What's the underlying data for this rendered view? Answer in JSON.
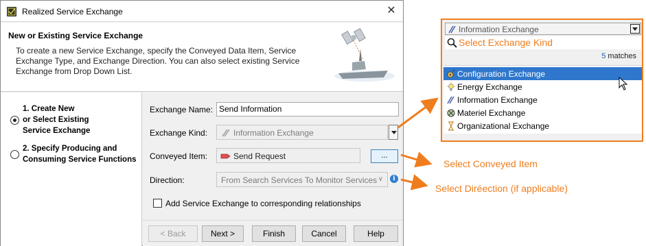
{
  "dialog": {
    "title": "Realized Service Exchange",
    "header_title": "New or Existing Service Exchange",
    "header_desc": "To create a new Service Exchange, specify the Conveyed Data Item, Service Exchange Type, and Exchange Direction. You can also select existing Service Exchange from Drop Down List.",
    "steps": [
      {
        "label_lines": [
          "1. Create New",
          "or Select Existing",
          "Service Exchange"
        ],
        "selected": true
      },
      {
        "label_lines": [
          "2. Specify Producing and",
          "Consuming Service Functions"
        ],
        "selected": false
      }
    ],
    "form": {
      "exchange_name_label": "Exchange Name:",
      "exchange_name_value": "Send Information",
      "exchange_kind_label": "Exchange Kind:",
      "exchange_kind_value": "Information Exchange",
      "conveyed_item_label": "Conveyed Item:",
      "conveyed_item_value": "Send Request",
      "browse_label": "...",
      "direction_label": "Direction:",
      "direction_value": "From Search Services To Monitor Services",
      "checkbox_label": "Add Service Exchange to corresponding relationships",
      "checkbox_checked": false
    },
    "buttons": {
      "back": "< Back",
      "next": "Next >",
      "finish": "Finish",
      "cancel": "Cancel",
      "help": "Help"
    }
  },
  "popup": {
    "combo_value": "Information Exchange",
    "search_placeholder": "Select Exchange Kind",
    "matches_count": "5",
    "matches_label": "matches",
    "items": [
      {
        "label": "Configuration Exchange",
        "icon": "configuration-exchange-icon",
        "selected": true
      },
      {
        "label": "Energy Exchange",
        "icon": "energy-exchange-icon",
        "selected": false
      },
      {
        "label": "Information Exchange",
        "icon": "information-exchange-icon",
        "selected": false
      },
      {
        "label": "Materiel Exchange",
        "icon": "materiel-exchange-icon",
        "selected": false
      },
      {
        "label": "Organizational Exchange",
        "icon": "organizational-exchange-icon",
        "selected": false
      }
    ]
  },
  "annotations": {
    "conveyed": "Select Conveyed Item",
    "direction": "Select Diréection (if applicable)"
  },
  "colors": {
    "accent_orange": "#f07d1d",
    "selection_blue": "#2f77cc"
  }
}
